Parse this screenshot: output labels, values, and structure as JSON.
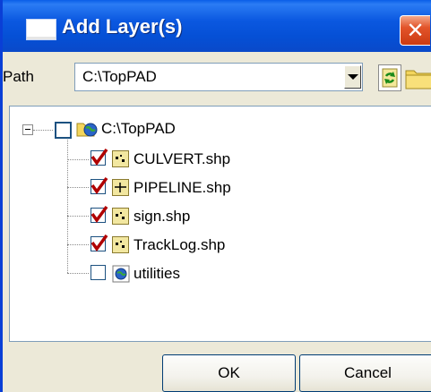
{
  "window": {
    "title": "Add Layer(s)",
    "close_glyph": "✕"
  },
  "path": {
    "label": "Path",
    "value": "C:\\TopPAD"
  },
  "tree": {
    "root": {
      "label": "C:\\TopPAD",
      "checked": false,
      "icon": "globe-folder-icon"
    },
    "children": [
      {
        "label": "CULVERT.shp",
        "checked": true,
        "icon": "point-layer-icon"
      },
      {
        "label": "PIPELINE.shp",
        "checked": true,
        "icon": "line-layer-icon"
      },
      {
        "label": "sign.shp",
        "checked": true,
        "icon": "point-layer-icon"
      },
      {
        "label": "TrackLog.shp",
        "checked": true,
        "icon": "point-layer-icon"
      },
      {
        "label": "utilities",
        "checked": false,
        "icon": "globe-folder-icon"
      }
    ]
  },
  "buttons": {
    "ok": "OK",
    "cancel": "Cancel"
  },
  "colors": {
    "titlebar": "#0550d6",
    "check_mark": "#b00000",
    "close": "#e2542a"
  }
}
